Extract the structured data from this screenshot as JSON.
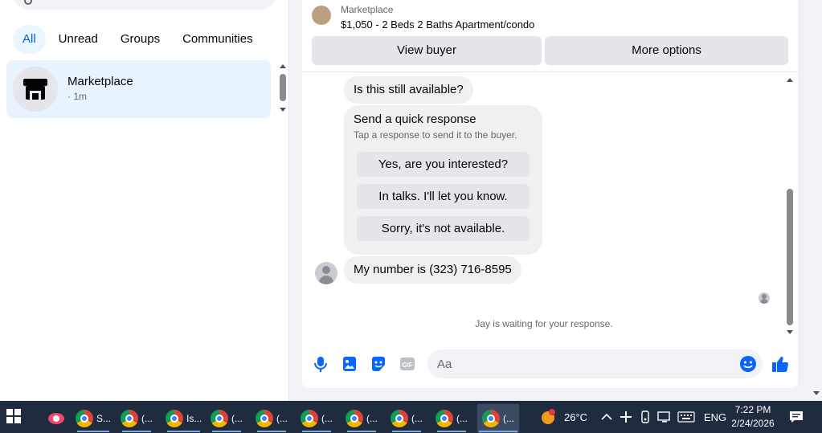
{
  "left": {
    "filters": [
      {
        "label": "All",
        "active": true
      },
      {
        "label": "Unread",
        "active": false
      },
      {
        "label": "Groups",
        "active": false
      },
      {
        "label": "Communities",
        "active": false
      }
    ],
    "thread": {
      "name": "Marketplace",
      "meta": "· 1m",
      "avatar_icon": "store-icon"
    }
  },
  "listing": {
    "source": "Marketplace",
    "title": "$1,050 - 2 Beds 2 Baths Apartment/condo",
    "buttons": {
      "view_buyer": "View buyer",
      "more_options": "More options"
    }
  },
  "messages": {
    "first": "Is this still available?",
    "quick_response": {
      "heading": "Send a quick response",
      "subtext": "Tap a response to send it to the buyer.",
      "options": [
        "Yes, are you interested?",
        "In talks. I'll let you know.",
        "Sorry, it's not available."
      ]
    },
    "second": "My number is (323) 716-8595",
    "waiting": "Jay is waiting for your response."
  },
  "composer": {
    "placeholder": "Aa",
    "icons": [
      "microphone-icon",
      "image-icon",
      "sticker-icon",
      "gif-icon",
      "emoji-icon",
      "like-icon"
    ],
    "accent": "#0866ff"
  },
  "taskbar": {
    "apps": [
      "S...",
      "(...",
      "Is...",
      "(...",
      "(...",
      "(...",
      "(...",
      "(...",
      "(...",
      "(..."
    ],
    "weather": "26°C",
    "language": "ENG",
    "time": "7:22 PM",
    "date": "2/24/2026"
  }
}
